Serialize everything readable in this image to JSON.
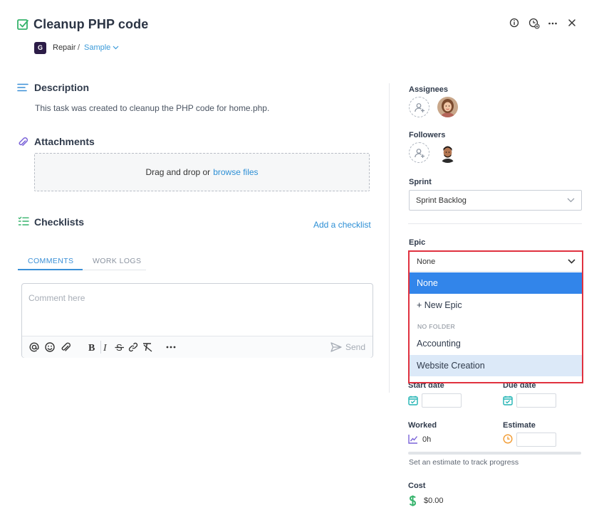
{
  "header": {
    "title": "Cleanup PHP code",
    "project_badge": "G",
    "project": "Repair",
    "separator": "/",
    "folder": "Sample"
  },
  "description": {
    "title": "Description",
    "text": "This task was created to cleanup the PHP code for home.php."
  },
  "attachments": {
    "title": "Attachments",
    "drop_text": "Drag and drop or",
    "browse_link": "browse files"
  },
  "checklists": {
    "title": "Checklists",
    "add_label": "Add a checklist"
  },
  "tabs": [
    {
      "label": "COMMENTS",
      "active": true
    },
    {
      "label": "WORK LOGS",
      "active": false
    }
  ],
  "comment": {
    "placeholder": "Comment here",
    "send_label": "Send"
  },
  "sidebar": {
    "assignees_label": "Assignees",
    "followers_label": "Followers",
    "sprint_label": "Sprint",
    "sprint_value": "Sprint Backlog",
    "epic_label": "Epic",
    "epic_value": "None",
    "epic_options": [
      {
        "label": "None",
        "state": "selected"
      },
      {
        "label": "+ New Epic",
        "state": "normal"
      }
    ],
    "epic_group_label": "NO FOLDER",
    "epic_group_options": [
      {
        "label": "Accounting",
        "state": "normal"
      },
      {
        "label": "Website Creation",
        "state": "hovered"
      }
    ],
    "start_date_label": "Start date",
    "due_date_label": "Due date",
    "worked_label": "Worked",
    "worked_value": "0h",
    "estimate_label": "Estimate",
    "progress_fraction": 0,
    "estimate_hint": "Set an estimate to track progress",
    "cost_label": "Cost",
    "cost_value": "$0.00"
  },
  "colors": {
    "accent": "#3a8fd6",
    "success": "#35b36b",
    "highlight_border": "#e0313f",
    "selected_option": "#3285ea",
    "teal_icon": "#1fb3b3",
    "orange_icon": "#f29b31",
    "purple_icon": "#7a63d8"
  },
  "icons": {
    "title": "checkbox-check-icon",
    "info": "info-icon",
    "timer": "clock-add-icon",
    "more": "more-horizontal-icon",
    "close": "close-icon"
  }
}
